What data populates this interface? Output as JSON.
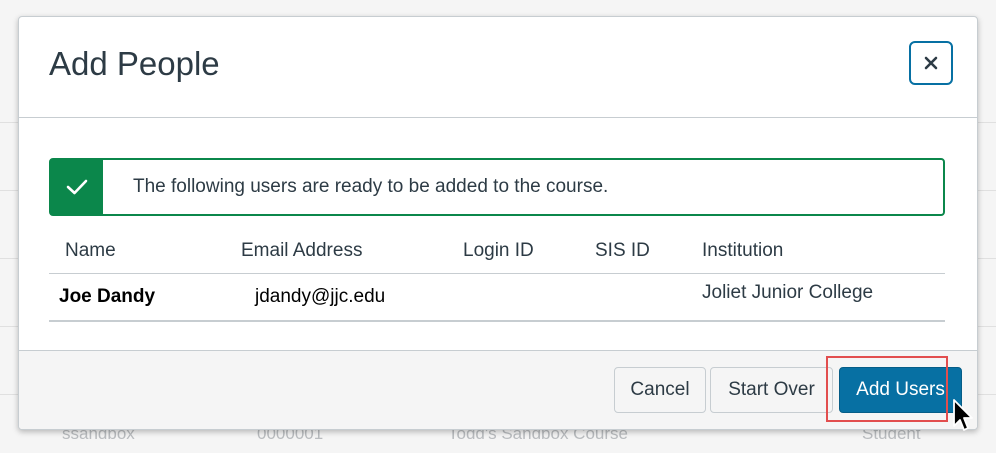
{
  "background": {
    "row": [
      "ssandbox",
      "0000001",
      "Todd's Sandbox Course",
      "Student"
    ]
  },
  "modal": {
    "title": "Add People",
    "close_icon": "close-icon",
    "alert": {
      "icon": "checkmark-icon",
      "message": "The following users are ready to be added to the course."
    },
    "table": {
      "headers": [
        "Name",
        "Email Address",
        "Login ID",
        "SIS ID",
        "Institution"
      ],
      "rows": [
        {
          "name": "Joe Dandy",
          "email": "jdandy@jjc.edu",
          "login_id": "",
          "sis_id": "",
          "institution": "Joliet Junior College"
        }
      ]
    },
    "footer": {
      "cancel_label": "Cancel",
      "start_over_label": "Start Over",
      "add_users_label": "Add Users"
    }
  },
  "colors": {
    "primary": "#0770a3",
    "success": "#0b874b",
    "highlight": "#e24e4e"
  }
}
